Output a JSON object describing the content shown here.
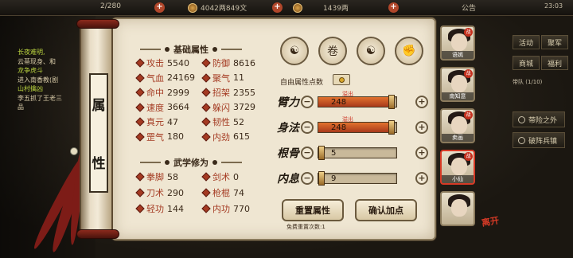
{
  "topbar": {
    "energy": "2/280",
    "silver": "4042两849文",
    "gold": "1439两",
    "notice": "公告",
    "time": "23:03"
  },
  "quest_log": {
    "lines": [
      "长夜难明,",
      "云蒂现身、和",
      "龙争虎斗",
      "进入南香教(剧",
      "山村擒凶",
      "李五抓了王老三",
      "品"
    ]
  },
  "scroll": {
    "chars": [
      "属",
      "性"
    ]
  },
  "basic": {
    "title": "基础属性",
    "stats": [
      {
        "label": "攻击",
        "value": "5540"
      },
      {
        "label": "防御",
        "value": "8616"
      },
      {
        "label": "气血",
        "value": "24169"
      },
      {
        "label": "聚气",
        "value": "11"
      },
      {
        "label": "命中",
        "value": "2999"
      },
      {
        "label": "招架",
        "value": "2355"
      },
      {
        "label": "速度",
        "value": "3664"
      },
      {
        "label": "躲闪",
        "value": "3729"
      },
      {
        "label": "真元",
        "value": "47"
      },
      {
        "label": "韧性",
        "value": "52"
      },
      {
        "label": "罡气",
        "value": "180"
      },
      {
        "label": "内劲",
        "value": "615"
      }
    ]
  },
  "martial": {
    "title": "武学修为",
    "stats": [
      {
        "label": "拳脚",
        "value": "58"
      },
      {
        "label": "剑术",
        "value": "0"
      },
      {
        "label": "刀术",
        "value": "290"
      },
      {
        "label": "枪棍",
        "value": "74"
      },
      {
        "label": "轻功",
        "value": "144"
      },
      {
        "label": "内功",
        "value": "770"
      }
    ]
  },
  "free_points": {
    "label": "自由属性点数"
  },
  "attributes": [
    {
      "label": "臂力",
      "value": "248",
      "overflow": "溢出",
      "fill": 0.96
    },
    {
      "label": "身法",
      "value": "248",
      "overflow": "溢出",
      "fill": 0.96
    },
    {
      "label": "根骨",
      "value": "5",
      "overflow": "",
      "fill": 0.02
    },
    {
      "label": "内息",
      "value": "9",
      "overflow": "",
      "fill": 0.03
    }
  ],
  "buttons": {
    "reset": "重置属性",
    "confirm": "确认加点",
    "free_reset": "免费重置次数:1"
  },
  "portraits": [
    {
      "name": "语嫣",
      "badge": "战"
    },
    {
      "name": "南知意",
      "badge": "战"
    },
    {
      "name": "卖画",
      "badge": "战"
    },
    {
      "name": "小仙",
      "badge": "战"
    },
    {
      "name": "",
      "badge": ""
    }
  ],
  "leave_label": "离开",
  "right_menu": {
    "activity": "活动",
    "shop": "商城",
    "rank": "聚军",
    "welfare": "福利",
    "team": "带队",
    "team_value": "(1/10)",
    "quests": [
      "带险之外",
      "破阵兵镇"
    ]
  }
}
